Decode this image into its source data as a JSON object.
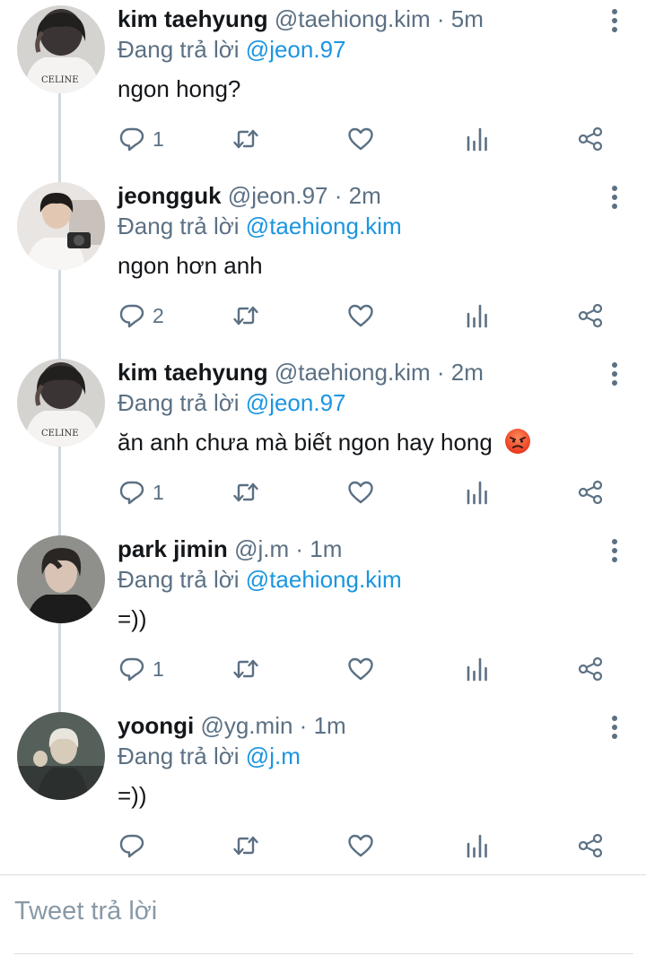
{
  "colors": {
    "accent": "#1b95e0",
    "muted": "#5b7083",
    "text": "#14171a",
    "divider": "#cfd9de"
  },
  "reply_prefix": "Đang trả lời",
  "tweets": [
    {
      "name": "kim taehyung",
      "handle": "@taehiong.kim",
      "sep": "·",
      "time": "5m",
      "reply_to": "@jeon.97",
      "text": "ngon hong?",
      "reply_count": "1",
      "avatar_logo": "CELINE"
    },
    {
      "name": "jeongguk",
      "handle": "@jeon.97",
      "sep": "·",
      "time": "2m",
      "reply_to": "@taehiong.kim",
      "text": "ngon hơn anh",
      "reply_count": "2"
    },
    {
      "name": "kim taehyung",
      "handle": "@taehiong.kim",
      "sep": "·",
      "time": "2m",
      "reply_to": "@jeon.97",
      "text": "ăn anh chưa mà biết ngon hay hong",
      "reply_count": "1",
      "avatar_logo": "CELINE"
    },
    {
      "name": "park jimin",
      "handle": "@j.m",
      "sep": "·",
      "time": "1m",
      "reply_to": "@taehiong.kim",
      "text": "=))",
      "reply_count": "1"
    },
    {
      "name": "yoongi",
      "handle": "@yg.min",
      "sep": "·",
      "time": "1m",
      "reply_to": "@j.m",
      "text": "=))",
      "reply_count": ""
    }
  ],
  "compose": {
    "placeholder": "Tweet trả lời"
  },
  "icons": [
    "reply-icon",
    "retweet-icon",
    "like-icon",
    "analytics-icon",
    "share-icon",
    "more-icon"
  ]
}
